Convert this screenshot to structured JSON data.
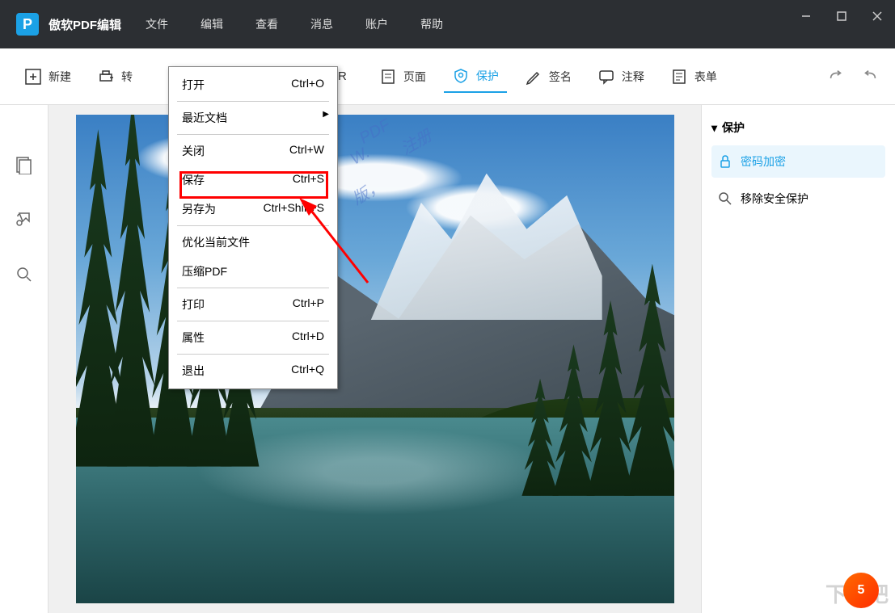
{
  "app": {
    "title": "傲软PDF编辑"
  },
  "menu": {
    "file": "文件",
    "edit": "编辑",
    "view": "查看",
    "message": "消息",
    "account": "账户",
    "help": "帮助"
  },
  "toolbar": {
    "new": "新建",
    "convert": "转",
    "ocr": "R",
    "page": "页面",
    "protect": "保护",
    "sign": "签名",
    "comment": "注释",
    "form": "表单"
  },
  "dropdown": {
    "open": {
      "label": "打开",
      "shortcut": "Ctrl+O"
    },
    "recent": {
      "label": "最近文档"
    },
    "close": {
      "label": "关闭",
      "shortcut": "Ctrl+W"
    },
    "save": {
      "label": "保存",
      "shortcut": "Ctrl+S"
    },
    "saveas": {
      "label": "另存为",
      "shortcut": "Ctrl+Shift+S"
    },
    "optimize": {
      "label": "优化当前文件"
    },
    "compress": {
      "label": "压缩PDF"
    },
    "print": {
      "label": "打印",
      "shortcut": "Ctrl+P"
    },
    "properties": {
      "label": "属性",
      "shortcut": "Ctrl+D"
    },
    "exit": {
      "label": "退出",
      "shortcut": "Ctrl+Q"
    }
  },
  "rightPanel": {
    "title": "保护",
    "encrypt": "密码加密",
    "remove": "移除安全保护"
  },
  "watermarks": {
    "pdf": "PDF",
    "register": "注册",
    "w": "W.",
    "ban": "版，",
    "download": "下载吧",
    "logo": "5"
  }
}
